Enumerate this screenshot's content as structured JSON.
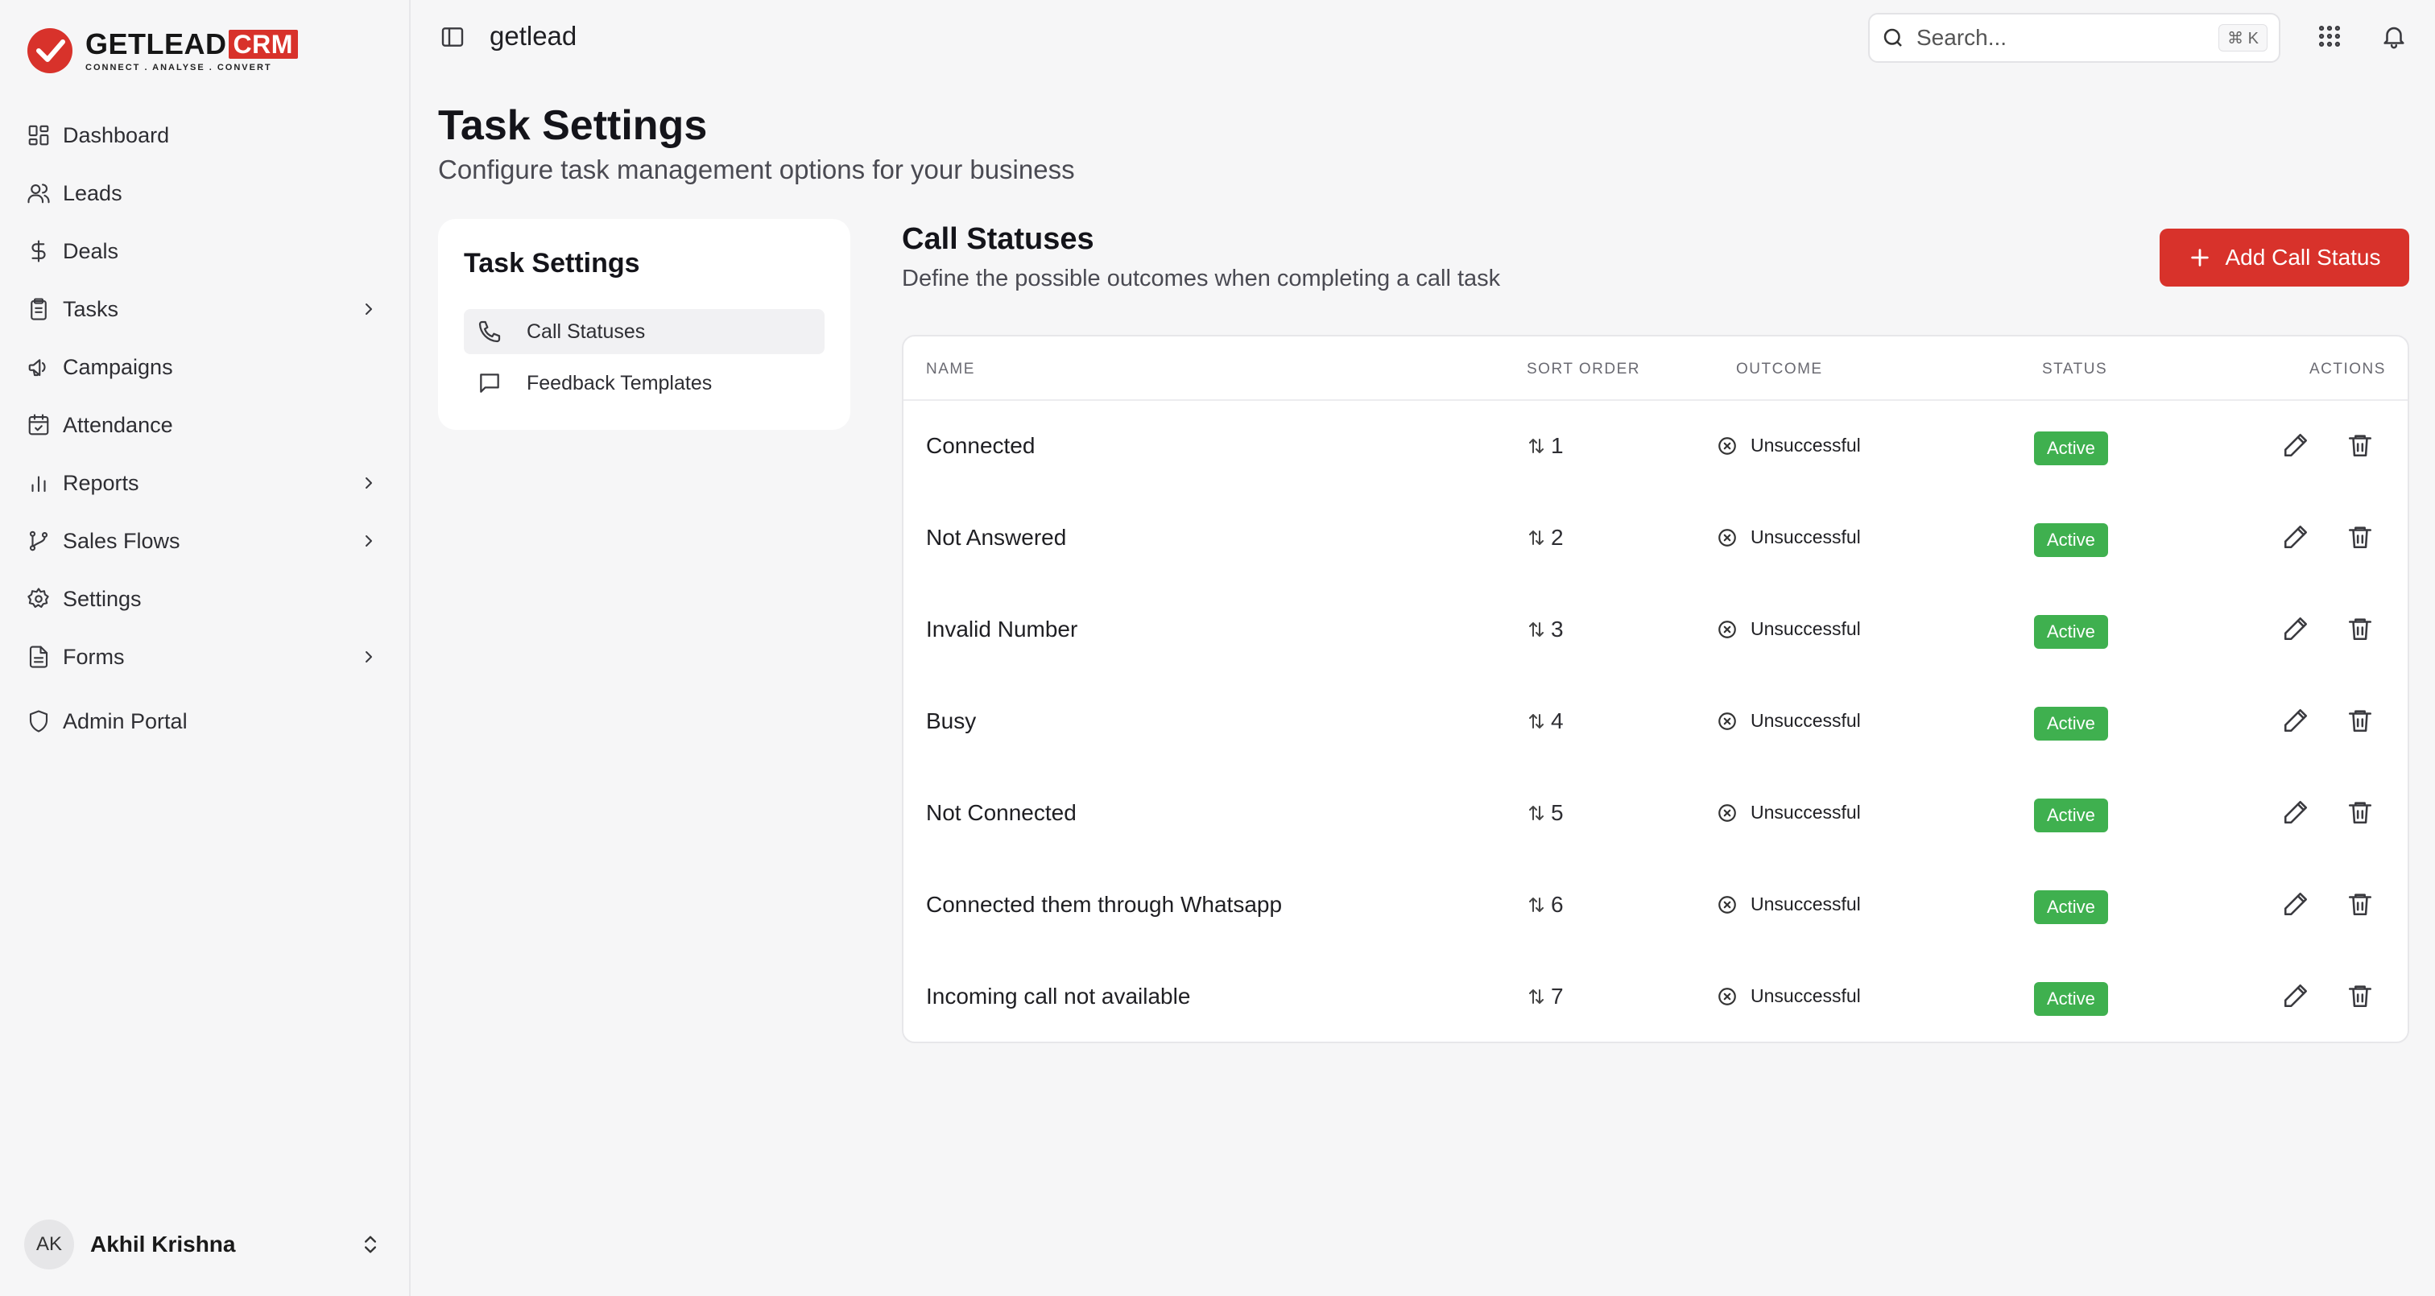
{
  "brand": {
    "name": "GETLEAD",
    "badge": "CRM",
    "tagline": "CONNECT . ANALYSE . CONVERT",
    "accent": "#d8322b"
  },
  "sidebar": {
    "items": [
      {
        "label": "Dashboard",
        "icon": "grid-icon",
        "has_chevron": false
      },
      {
        "label": "Leads",
        "icon": "users-icon",
        "has_chevron": false
      },
      {
        "label": "Deals",
        "icon": "dollar-icon",
        "has_chevron": false
      },
      {
        "label": "Tasks",
        "icon": "clipboard-icon",
        "has_chevron": true
      },
      {
        "label": "Campaigns",
        "icon": "megaphone-icon",
        "has_chevron": false
      },
      {
        "label": "Attendance",
        "icon": "calendar-check-icon",
        "has_chevron": false
      },
      {
        "label": "Reports",
        "icon": "bar-chart-icon",
        "has_chevron": true
      },
      {
        "label": "Sales Flows",
        "icon": "git-branch-icon",
        "has_chevron": true
      },
      {
        "label": "Settings",
        "icon": "gear-icon",
        "has_chevron": false
      },
      {
        "label": "Forms",
        "icon": "file-icon",
        "has_chevron": true
      },
      {
        "label": "Admin Portal",
        "icon": "shield-icon",
        "has_chevron": false
      }
    ],
    "user": {
      "initials": "AK",
      "name": "Akhil Krishna"
    }
  },
  "topbar": {
    "workspace": "getlead",
    "search_placeholder": "Search...",
    "search_shortcut": "⌘ K"
  },
  "page": {
    "title": "Task Settings",
    "subtitle": "Configure task management options for your business"
  },
  "settings_nav": {
    "title": "Task Settings",
    "items": [
      {
        "label": "Call Statuses",
        "icon": "phone-icon",
        "active": true
      },
      {
        "label": "Feedback Templates",
        "icon": "message-square-icon",
        "active": false
      }
    ]
  },
  "section": {
    "title": "Call Statuses",
    "subtitle": "Define the possible outcomes when completing a call task",
    "add_button": "Add Call Status"
  },
  "table": {
    "headers": {
      "name": "NAME",
      "sort_order": "SORT ORDER",
      "outcome": "OUTCOME",
      "status": "STATUS",
      "actions": "ACTIONS"
    },
    "status_color": "#3fb04f",
    "rows": [
      {
        "name": "Connected",
        "sort_order": "1",
        "outcome": "Unsuccessful",
        "status": "Active"
      },
      {
        "name": "Not Answered",
        "sort_order": "2",
        "outcome": "Unsuccessful",
        "status": "Active"
      },
      {
        "name": "Invalid Number",
        "sort_order": "3",
        "outcome": "Unsuccessful",
        "status": "Active"
      },
      {
        "name": "Busy",
        "sort_order": "4",
        "outcome": "Unsuccessful",
        "status": "Active"
      },
      {
        "name": "Not Connected",
        "sort_order": "5",
        "outcome": "Unsuccessful",
        "status": "Active"
      },
      {
        "name": "Connected them through Whatsapp",
        "sort_order": "6",
        "outcome": "Unsuccessful",
        "status": "Active"
      },
      {
        "name": "Incoming call not available",
        "sort_order": "7",
        "outcome": "Unsuccessful",
        "status": "Active"
      }
    ]
  }
}
